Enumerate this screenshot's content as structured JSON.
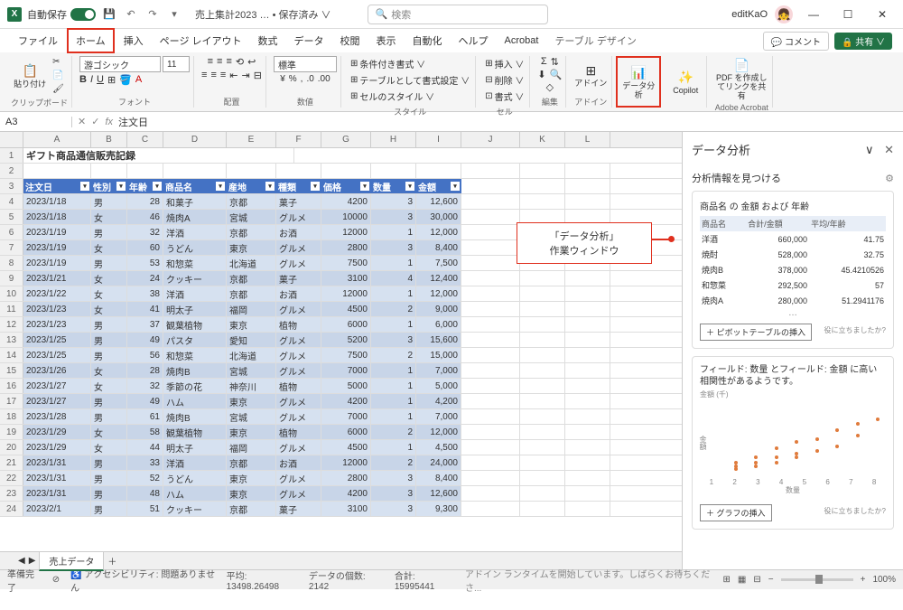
{
  "titlebar": {
    "autosave": "自動保存",
    "autosave_state": "オン",
    "filename": "売上集計2023 … • 保存済み ∨",
    "search_placeholder": "検索",
    "username": "editKaO",
    "avatar": "👧"
  },
  "tabs": {
    "file": "ファイル",
    "home": "ホーム",
    "insert": "挿入",
    "page_layout": "ページ レイアウト",
    "formulas": "数式",
    "data": "データ",
    "review": "校閲",
    "view": "表示",
    "auto": "自動化",
    "help": "ヘルプ",
    "acrobat": "Acrobat",
    "table_design": "テーブル デザイン",
    "comment": "コメント",
    "share": "共有"
  },
  "ribbon": {
    "paste": "貼り付け",
    "clipboard": "クリップボード",
    "font_name": "游ゴシック",
    "font_size": "11",
    "font": "フォント",
    "alignment": "配置",
    "number_format": "標準",
    "number": "数値",
    "cond_format": "条件付き書式 ∨",
    "table_format": "テーブルとして書式設定 ∨",
    "cell_style": "セルのスタイル ∨",
    "style": "スタイル",
    "insert": "挿入 ∨",
    "delete": "削除 ∨",
    "format": "書式 ∨",
    "cells": "セル",
    "editing": "編集",
    "addin": "アドイン",
    "analysis": "データ分析",
    "copilot": "Copilot",
    "pdf": "PDF を作成してリンクを共有",
    "adobe": "Adobe Acrobat"
  },
  "namebox": {
    "ref": "A3",
    "formula": "注文日"
  },
  "sheet": {
    "title": "ギフト商品通信販売記録",
    "columns": [
      "A",
      "B",
      "C",
      "D",
      "E",
      "F",
      "G",
      "H",
      "I",
      "J",
      "K",
      "L"
    ],
    "widths": [
      75,
      40,
      40,
      70,
      55,
      50,
      55,
      50,
      50,
      65,
      50,
      50
    ],
    "headers": [
      "注文日",
      "性別",
      "年齢",
      "商品名",
      "産地",
      "種類",
      "価格",
      "数量",
      "金額"
    ],
    "rows": [
      [
        "2023/1/18",
        "男",
        "28",
        "和菓子",
        "京都",
        "菓子",
        "4200",
        "3",
        "12,600"
      ],
      [
        "2023/1/18",
        "女",
        "46",
        "焼肉A",
        "宮城",
        "グルメ",
        "10000",
        "3",
        "30,000"
      ],
      [
        "2023/1/19",
        "男",
        "32",
        "洋酒",
        "京都",
        "お酒",
        "12000",
        "1",
        "12,000"
      ],
      [
        "2023/1/19",
        "女",
        "60",
        "うどん",
        "東京",
        "グルメ",
        "2800",
        "3",
        "8,400"
      ],
      [
        "2023/1/19",
        "男",
        "53",
        "和惣菜",
        "北海道",
        "グルメ",
        "7500",
        "1",
        "7,500"
      ],
      [
        "2023/1/21",
        "女",
        "24",
        "クッキー",
        "京都",
        "菓子",
        "3100",
        "4",
        "12,400"
      ],
      [
        "2023/1/22",
        "女",
        "38",
        "洋酒",
        "京都",
        "お酒",
        "12000",
        "1",
        "12,000"
      ],
      [
        "2023/1/23",
        "女",
        "41",
        "明太子",
        "福岡",
        "グルメ",
        "4500",
        "2",
        "9,000"
      ],
      [
        "2023/1/23",
        "男",
        "37",
        "観葉植物",
        "東京",
        "植物",
        "6000",
        "1",
        "6,000"
      ],
      [
        "2023/1/25",
        "男",
        "49",
        "パスタ",
        "愛知",
        "グルメ",
        "5200",
        "3",
        "15,600"
      ],
      [
        "2023/1/25",
        "男",
        "56",
        "和惣菜",
        "北海道",
        "グルメ",
        "7500",
        "2",
        "15,000"
      ],
      [
        "2023/1/26",
        "女",
        "28",
        "焼肉B",
        "宮城",
        "グルメ",
        "7000",
        "1",
        "7,000"
      ],
      [
        "2023/1/27",
        "女",
        "32",
        "季節の花",
        "神奈川",
        "植物",
        "5000",
        "1",
        "5,000"
      ],
      [
        "2023/1/27",
        "男",
        "49",
        "ハム",
        "東京",
        "グルメ",
        "4200",
        "1",
        "4,200"
      ],
      [
        "2023/1/28",
        "男",
        "61",
        "焼肉B",
        "宮城",
        "グルメ",
        "7000",
        "1",
        "7,000"
      ],
      [
        "2023/1/29",
        "女",
        "58",
        "観葉植物",
        "東京",
        "植物",
        "6000",
        "2",
        "12,000"
      ],
      [
        "2023/1/29",
        "女",
        "44",
        "明太子",
        "福岡",
        "グルメ",
        "4500",
        "1",
        "4,500"
      ],
      [
        "2023/1/31",
        "男",
        "33",
        "洋酒",
        "京都",
        "お酒",
        "12000",
        "2",
        "24,000"
      ],
      [
        "2023/1/31",
        "男",
        "52",
        "うどん",
        "東京",
        "グルメ",
        "2800",
        "3",
        "8,400"
      ],
      [
        "2023/1/31",
        "男",
        "48",
        "ハム",
        "東京",
        "グルメ",
        "4200",
        "3",
        "12,600"
      ],
      [
        "2023/2/1",
        "男",
        "51",
        "クッキー",
        "京都",
        "菓子",
        "3100",
        "3",
        "9,300"
      ]
    ],
    "tab_name": "売上データ"
  },
  "callout": {
    "line1": "「データ分析」",
    "line2": "作業ウィンドウ"
  },
  "analysis": {
    "title": "データ分析",
    "find": "分析情報を見つける",
    "card1_title": "商品名 の 金額 および 年齢",
    "table_headers": [
      "商品名",
      "合計/金額",
      "平均/年齢"
    ],
    "table_rows": [
      [
        "洋酒",
        "660,000",
        "41.75"
      ],
      [
        "焼酎",
        "528,000",
        "32.75"
      ],
      [
        "焼肉B",
        "378,000",
        "45.4210526"
      ],
      [
        "和惣菜",
        "292,500",
        "57"
      ],
      [
        "焼肉A",
        "280,000",
        "51.2941176"
      ]
    ],
    "ellipsis": "…",
    "insert_pivot": "＋ ピボットテーブルの挿入",
    "helpful": "役に立ちましたか?",
    "card2_text": "フィールド: 数量 とフィールド: 金額 に高い相関性があるようです。",
    "ylabel": "金額 (千)",
    "xlabel": "数量",
    "insert_chart": "＋ グラフの挿入"
  },
  "statusbar": {
    "ready": "準備完了",
    "accessibility": "アクセシビリティ: 問題ありません",
    "avg": "平均: 13498.26498",
    "count": "データの個数: 2142",
    "sum": "合計: 15995441",
    "addin_msg": "アドイン ランタイムを開始しています。しばらくお待ちくださ...",
    "zoom": "100%"
  },
  "chart_data": {
    "type": "scatter",
    "title": "",
    "xlabel": "数量",
    "ylabel": "金額 (千)",
    "x": [
      1,
      1,
      1,
      2,
      2,
      2,
      3,
      3,
      3,
      4,
      4,
      4,
      5,
      5,
      6,
      6,
      7,
      7,
      8
    ],
    "y": [
      5,
      8,
      12,
      8,
      12,
      18,
      12,
      18,
      28,
      18,
      22,
      35,
      25,
      38,
      30,
      48,
      42,
      55,
      60
    ],
    "xlim": [
      0,
      8
    ],
    "ylim": [
      0,
      70
    ]
  }
}
